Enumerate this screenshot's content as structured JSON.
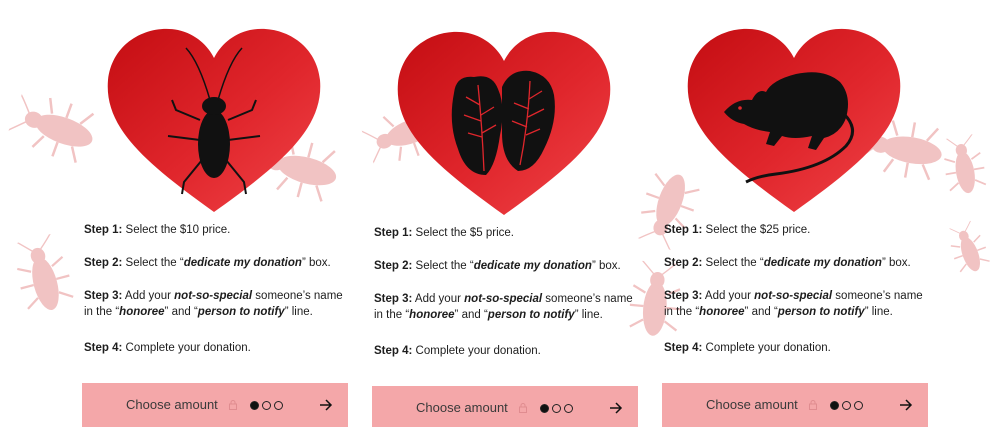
{
  "colors": {
    "heart": "#e0262c",
    "button": "#f4a7a9",
    "roach_bg": "#f1c3c3"
  },
  "cards": [
    {
      "icon": "cockroach-icon",
      "step1_label": "Step 1:",
      "step1_text": " Select the $10 price.",
      "step2_label": "Step 2:",
      "step2_a": " Select the “",
      "step2_em": "dedicate my donation",
      "step2_b": "” box.",
      "step3_label": "Step 3:",
      "step3_a": " Add your ",
      "step3_em1": "not-so-special",
      "step3_b": " someone’s name in the “",
      "step3_em2": "honoree",
      "step3_c": "” and “",
      "step3_em3": "person to notify",
      "step3_d": "” line.",
      "step4_label": "Step 4:",
      "step4_text": " Complete your donation.",
      "button_label": "Choose amount"
    },
    {
      "icon": "lettuce-icon",
      "step1_label": "Step 1:",
      "step1_text": " Select the $5 price.",
      "step2_label": "Step 2:",
      "step2_a": " Select the “",
      "step2_em": "dedicate my donation",
      "step2_b": "” box.",
      "step3_label": "Step 3:",
      "step3_a": " Add your ",
      "step3_em1": "not-so-special",
      "step3_b": " someone’s name in the “",
      "step3_em2": "honoree",
      "step3_c": "” and “",
      "step3_em3": "person to notify",
      "step3_d": "” line.",
      "step4_label": "Step 4:",
      "step4_text": " Complete your donation.",
      "button_label": "Choose amount"
    },
    {
      "icon": "rat-icon",
      "step1_label": "Step 1:",
      "step1_text": " Select the $25 price.",
      "step2_label": "Step 2:",
      "step2_a": " Select the “",
      "step2_em": "dedicate my donation",
      "step2_b": "” box.",
      "step3_label": "Step 3:",
      "step3_a": " Add your ",
      "step3_em1": "not-so-special",
      "step3_b": " someone’s name in the “",
      "step3_em2": "honoree",
      "step3_c": "” and “",
      "step3_em3": "person to notify",
      "step3_d": "” line.",
      "step4_label": "Step 4:",
      "step4_text": " Complete your donation.",
      "button_label": "Choose amount"
    }
  ]
}
